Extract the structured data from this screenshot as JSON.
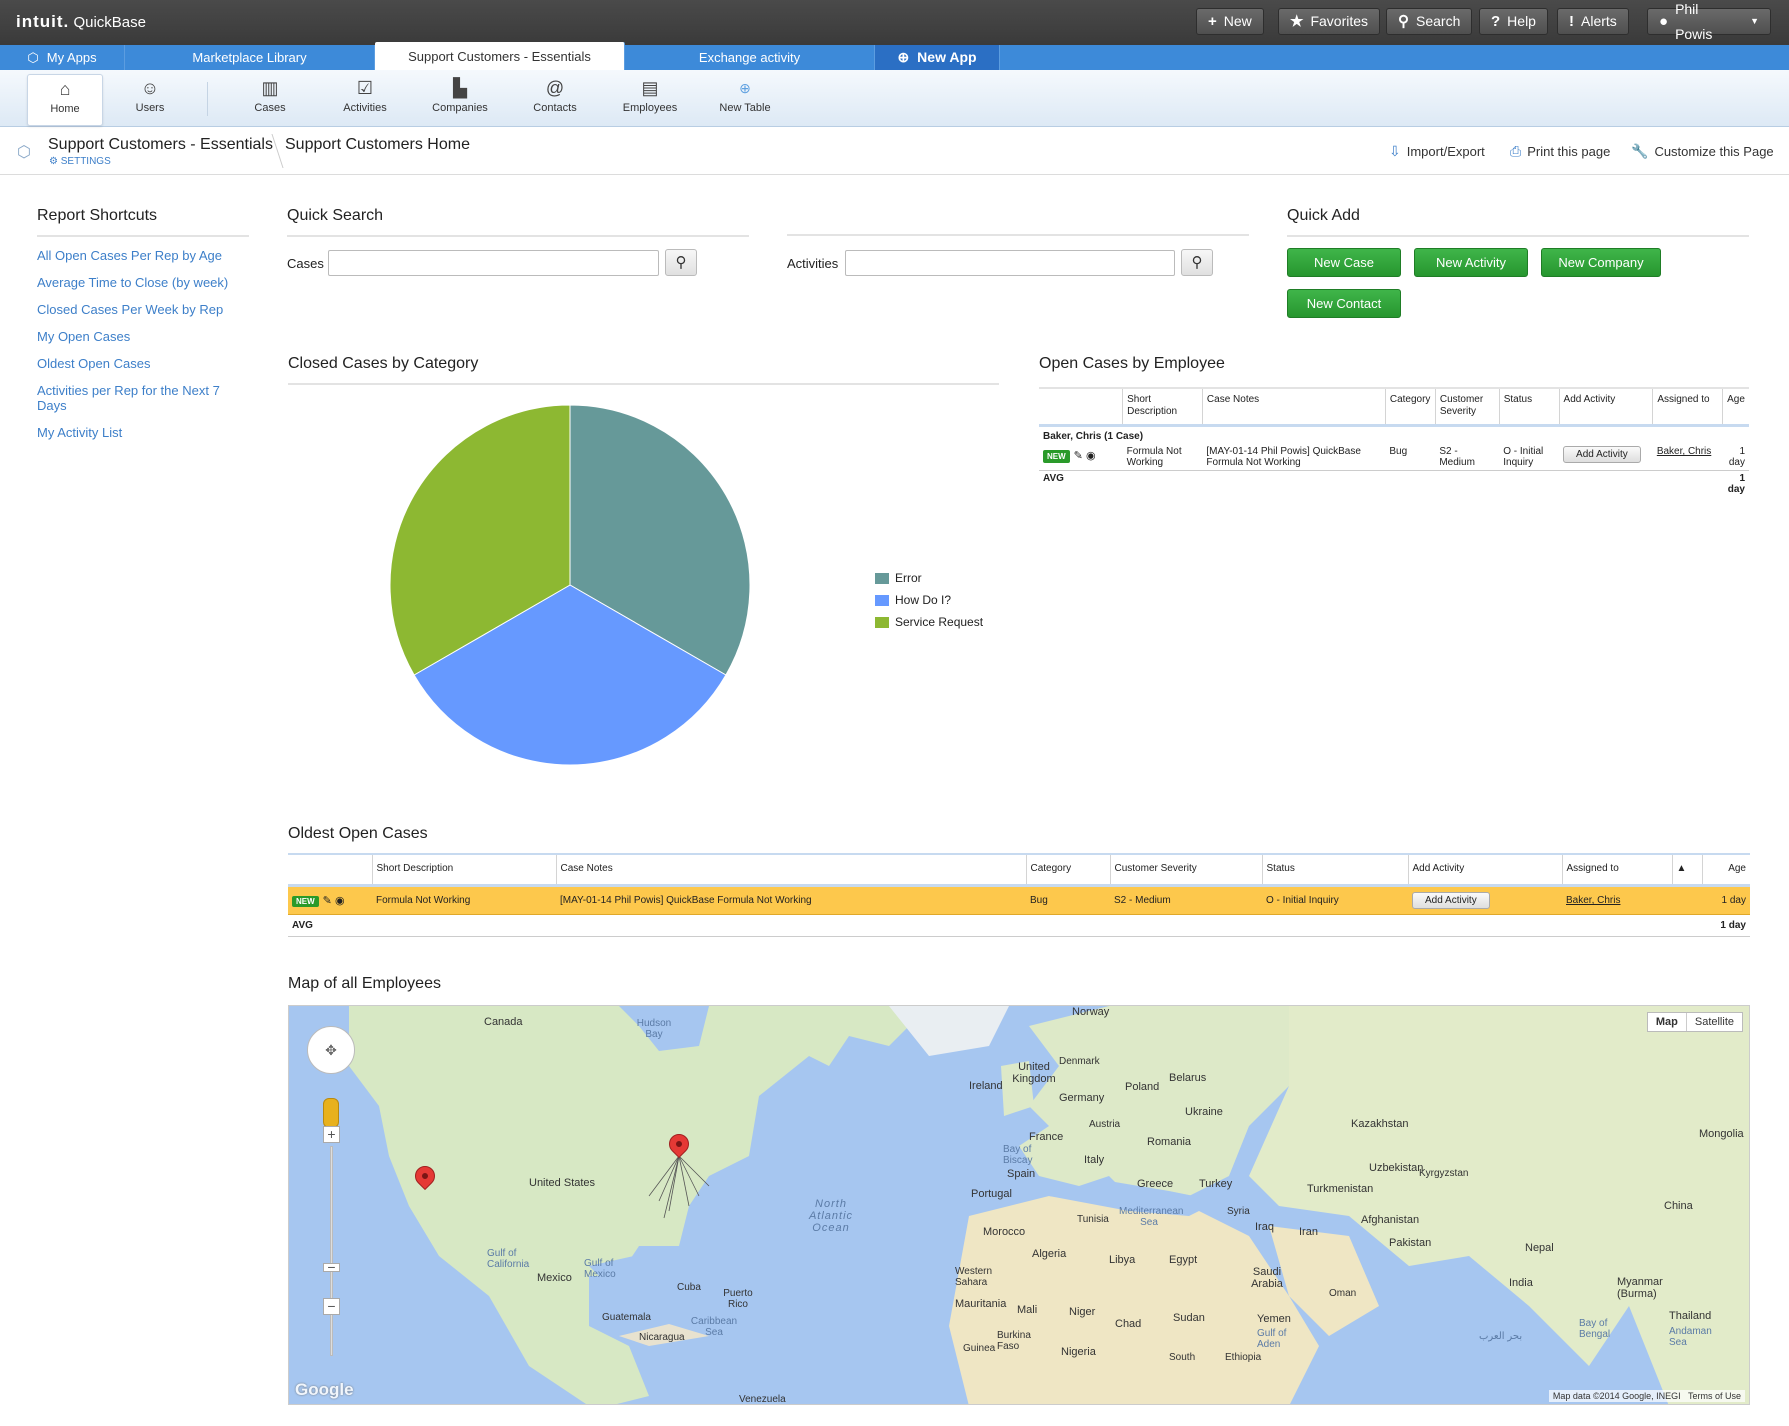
{
  "topbar": {
    "logo_brand": "intuit.",
    "logo_product": "QuickBase",
    "buttons": {
      "new": "New",
      "favorites": "Favorites",
      "search": "Search",
      "help": "Help",
      "alerts": "Alerts",
      "user": "Phil Powis"
    }
  },
  "apptabs": {
    "my_apps": "My Apps",
    "marketplace": "Marketplace Library",
    "support": "Support Customers - Essentials",
    "exchange": "Exchange activity",
    "new_app": "New App"
  },
  "nav": {
    "home": "Home",
    "users": "Users",
    "cases": "Cases",
    "activities": "Activities",
    "companies": "Companies",
    "contacts": "Contacts",
    "employees": "Employees",
    "new_table": "New Table"
  },
  "pagehead": {
    "app_name": "Support Customers - Essentials",
    "settings": "SETTINGS",
    "page_name": "Support Customers Home",
    "import_export": "Import/Export",
    "print": "Print this page",
    "customize": "Customize this Page"
  },
  "shortcuts": {
    "title": "Report Shortcuts",
    "items": [
      "All Open Cases Per Rep by Age",
      "Average Time to Close (by week)",
      "Closed Cases Per Week by Rep",
      "My Open Cases",
      "Oldest Open Cases",
      "Activities per Rep for the Next 7 Days",
      "My Activity List"
    ]
  },
  "quick_search": {
    "title": "Quick Search",
    "cases_label": "Cases",
    "activities_label": "Activities",
    "cases_value": "",
    "activities_value": ""
  },
  "quick_add": {
    "title": "Quick Add",
    "new_case": "New Case",
    "new_activity": "New Activity",
    "new_company": "New Company",
    "new_contact": "New Contact"
  },
  "chart_data": {
    "type": "pie",
    "title": "Closed Cases by Category",
    "categories": [
      "Error",
      "How Do I?",
      "Service Request"
    ],
    "values": [
      1,
      1,
      1
    ],
    "colors": [
      "#669999",
      "#6699ff",
      "#8db832"
    ],
    "legend": "right"
  },
  "open_by_employee": {
    "title": "Open Cases by Employee",
    "headers": [
      "Short Description",
      "Case Notes",
      "Category",
      "Customer Severity",
      "Status",
      "Add Activity",
      "Assigned to",
      "Age"
    ],
    "group_label": "Baker, Chris  (1 Case)",
    "row": {
      "badge": "NEW",
      "short_description": "Formula Not Working",
      "case_notes": "[MAY-01-14 Phil Powis] QuickBase Formula Not Working",
      "category": "Bug",
      "severity": "S2 - Medium",
      "status": "O - Initial Inquiry",
      "add_activity": "Add Activity",
      "assigned_to": "Baker, Chris",
      "age": "1 day"
    },
    "avg_label": "AVG",
    "avg_age": "1 day"
  },
  "oldest_open": {
    "title": "Oldest Open Cases",
    "headers": [
      "Short Description",
      "Case Notes",
      "Category",
      "Customer Severity",
      "Status",
      "Add Activity",
      "Assigned to",
      "Age"
    ],
    "row": {
      "badge": "NEW",
      "short_description": "Formula Not Working",
      "case_notes": "[MAY-01-14 Phil Powis] QuickBase Formula Not Working",
      "category": "Bug",
      "severity": "S2 - Medium",
      "status": "O - Initial Inquiry",
      "add_activity": "Add Activity",
      "assigned_to": "Baker, Chris",
      "age": "1 day"
    },
    "avg_label": "AVG",
    "avg_age": "1 day"
  },
  "map": {
    "title": "Map of all Employees",
    "map_btn": "Map",
    "satellite_btn": "Satellite",
    "google": "Google",
    "attribution": "Map data ©2014 Google, INEGI",
    "terms": "Terms of Use",
    "labels": {
      "canada": "Canada",
      "hudson": "Hudson Bay",
      "us": "United States",
      "mexico": "Mexico",
      "cuba": "Cuba",
      "gulf_mexico": "Gulf of Mexico",
      "gulf_california": "Gulf of California",
      "guatemala": "Guatemala",
      "nicaragua": "Nicaragua",
      "caribbean": "Caribbean Sea",
      "puerto_rico": "Puerto Rico",
      "north_atlantic": "North Atlantic Ocean",
      "norway": "Norway",
      "uk": "United Kingdom",
      "ireland": "Ireland",
      "denmark": "Denmark",
      "germany": "Germany",
      "poland": "Poland",
      "belarus": "Belarus",
      "ukraine": "Ukraine",
      "france": "France",
      "spain": "Spain",
      "portugal": "Portugal",
      "italy": "Italy",
      "romania": "Romania",
      "greece": "Greece",
      "turkey": "Turkey",
      "kazakhstan": "Kazakhstan",
      "mongolia": "Mongolia",
      "uzbekistan": "Uzbekistan",
      "turkmenistan": "Turkmenistan",
      "kyrgyzstan": "Kyrgyzstan",
      "afghanistan": "Afghanistan",
      "pakistan": "Pakistan",
      "china": "China",
      "iran": "Iran",
      "iraq": "Iraq",
      "syria": "Syria",
      "morocco": "Morocco",
      "algeria": "Algeria",
      "libya": "Libya",
      "egypt": "Egypt",
      "saudi": "Saudi Arabia",
      "oman": "Oman",
      "yemen": "Yemen",
      "india": "India",
      "nepal": "Nepal",
      "myanmar": "Myanmar (Burma)",
      "thailand": "Thailand",
      "mali": "Mali",
      "niger": "Niger",
      "chad": "Chad",
      "sudan": "Sudan",
      "mauritania": "Mauritania",
      "nigeria": "Nigeria",
      "ethiopia": "Ethiopia",
      "western_sahara": "Western Sahara",
      "mediterranean": "Mediterranean Sea",
      "bay_biscay": "Bay of Biscay",
      "bay_bengal": "Bay of Bengal",
      "gulf_aden": "Gulf of Aden",
      "austria": "Austria",
      "tunisia": "Tunisia",
      "burkina": "Burkina Faso",
      "guinea": "Guinea",
      "south": "South",
      "andaman": "Andaman Sea",
      "arabic_sea": "بحر العرب",
      "venezuela": "Venezuela"
    }
  }
}
